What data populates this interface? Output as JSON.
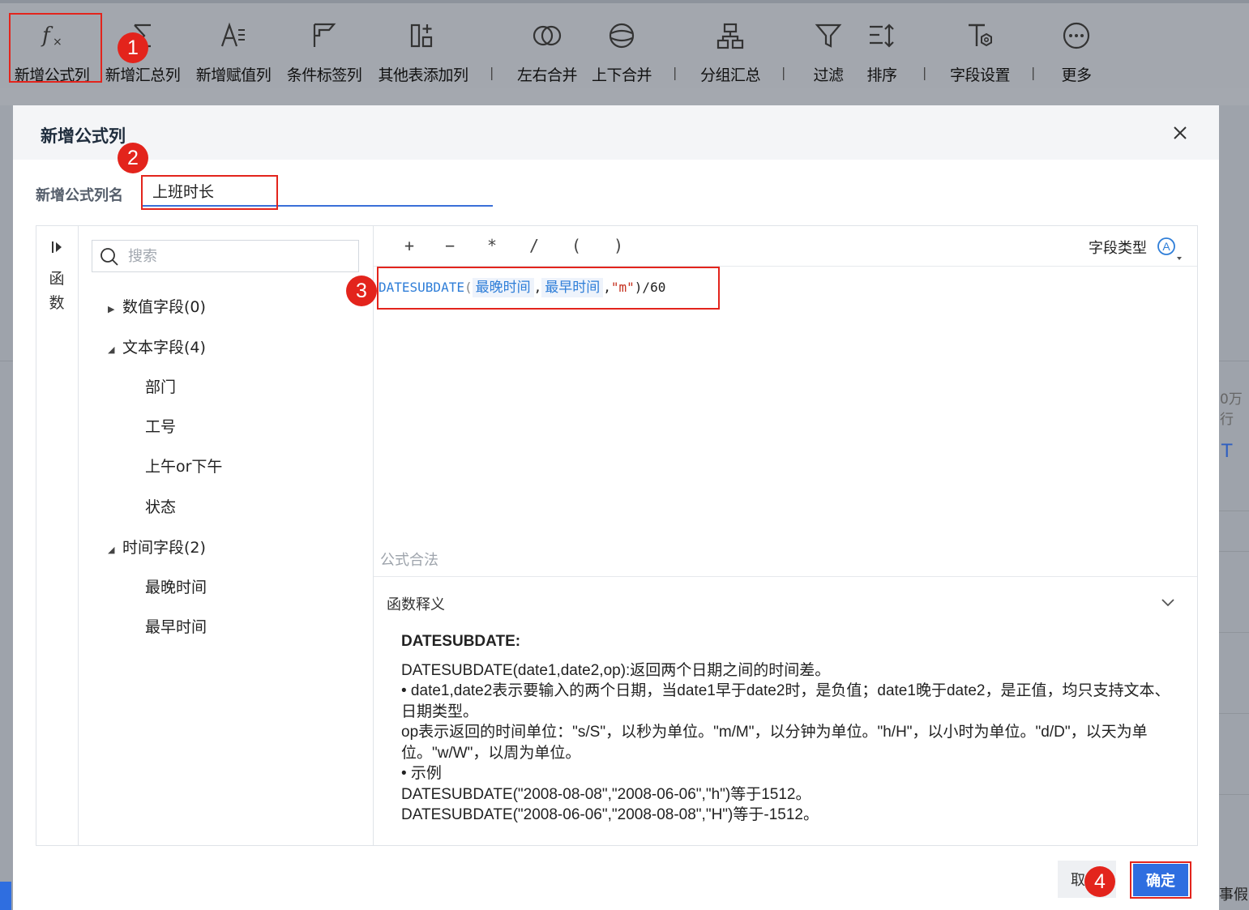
{
  "toolbar": {
    "items": [
      {
        "label": "新增公式列",
        "icon": "formula-fx-icon"
      },
      {
        "label": "新增汇总列",
        "icon": "sum-sigma-icon"
      },
      {
        "label": "新增赋值列",
        "icon": "assign-value-icon"
      },
      {
        "label": "条件标签列",
        "icon": "condition-tag-icon"
      },
      {
        "label": "其他表添加列",
        "icon": "add-column-icon"
      },
      {
        "label": "左右合并",
        "icon": "merge-horizontal-icon"
      },
      {
        "label": "上下合并",
        "icon": "merge-vertical-icon"
      },
      {
        "label": "分组汇总",
        "icon": "group-summary-icon"
      },
      {
        "label": "过滤",
        "icon": "filter-icon"
      },
      {
        "label": "排序",
        "icon": "sort-icon"
      },
      {
        "label": "字段设置",
        "icon": "field-settings-icon"
      },
      {
        "label": "更多",
        "icon": "more-dots-icon"
      }
    ],
    "separator": "|"
  },
  "background_fragments": {
    "right_text_1": "0万行",
    "right_text_2": "T",
    "right_text_3": "事假"
  },
  "dialog": {
    "title": "新增公式列",
    "name_label": "新增公式列名",
    "name_value": "上班时长",
    "rail_label": "函数",
    "search_placeholder": "搜索",
    "tree": {
      "groups": [
        {
          "label": "数值字段(0)",
          "expanded": false,
          "children": []
        },
        {
          "label": "文本字段(4)",
          "expanded": true,
          "children": [
            "部门",
            "工号",
            "上午or下午",
            "状态"
          ]
        },
        {
          "label": "时间字段(2)",
          "expanded": true,
          "children": [
            "最晚时间",
            "最早时间"
          ]
        }
      ]
    },
    "operators": [
      "+",
      "−",
      "*",
      "/",
      "(",
      ")"
    ],
    "field_type_label": "字段类型",
    "formula": {
      "function": "DATESUBDATE",
      "open_paren": "(",
      "arg1": "最晚时间",
      "comma1": ",",
      "arg2": "最早时间",
      "comma2": ",",
      "arg3": "\"m\"",
      "tail": ")/60"
    },
    "validity_text": "公式合法",
    "doc": {
      "section_title": "函数释义",
      "heading": "DATESUBDATE:",
      "lines": [
        "DATESUBDATE(date1,date2,op):返回两个日期之间的时间差。",
        "•  date1,date2表示要输入的两个日期，当date1早于date2时，是负值；date1晚于date2，是正值，均只支持文本、日期类型。",
        "op表示返回的时间单位：\"s/S\"，以秒为单位。\"m/M\"，以分钟为单位。\"h/H\"，以小时为单位。\"d/D\"，以天为单位。\"w/W\"，以周为单位。",
        "•  示例",
        "DATESUBDATE(\"2008-08-08\",\"2008-06-06\",\"h\")等于1512。",
        "DATESUBDATE(\"2008-06-06\",\"2008-08-08\",\"H\")等于-1512。"
      ]
    },
    "buttons": {
      "cancel_label": "取",
      "ok_label": "确定"
    }
  },
  "annotations": {
    "badges": [
      "1",
      "2",
      "3",
      "4"
    ],
    "highlight_color": "#e3241c"
  },
  "colors": {
    "accent": "#2f6ee0",
    "function_blue": "#2f7ed8",
    "string_red": "#c42d1b"
  }
}
